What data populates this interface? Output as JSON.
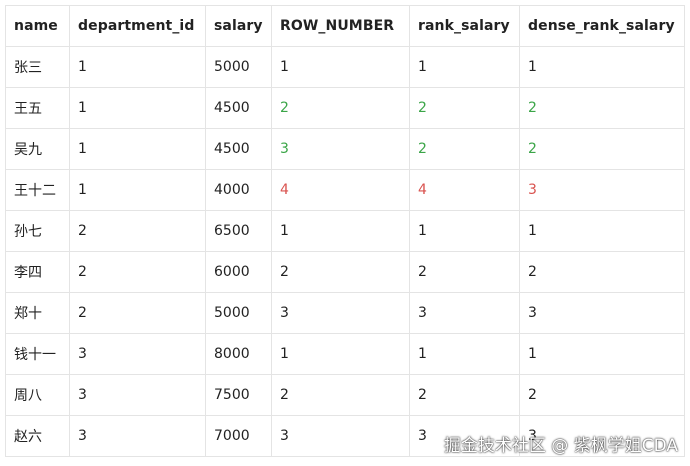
{
  "table": {
    "columns": [
      "name",
      "department_id",
      "salary",
      "ROW_NUMBER",
      "rank_salary",
      "dense_rank_salary"
    ],
    "rows": [
      {
        "name": "张三",
        "department_id": "1",
        "salary": "5000",
        "row_number": "1",
        "rank_salary": "1",
        "dense_rank_salary": "1"
      },
      {
        "name": "王五",
        "department_id": "1",
        "salary": "4500",
        "row_number": "2",
        "rank_salary": "2",
        "dense_rank_salary": "2"
      },
      {
        "name": "吴九",
        "department_id": "1",
        "salary": "4500",
        "row_number": "3",
        "rank_salary": "2",
        "dense_rank_salary": "2"
      },
      {
        "name": "王十二",
        "department_id": "1",
        "salary": "4000",
        "row_number": "4",
        "rank_salary": "4",
        "dense_rank_salary": "3"
      },
      {
        "name": "孙七",
        "department_id": "2",
        "salary": "6500",
        "row_number": "1",
        "rank_salary": "1",
        "dense_rank_salary": "1"
      },
      {
        "name": "李四",
        "department_id": "2",
        "salary": "6000",
        "row_number": "2",
        "rank_salary": "2",
        "dense_rank_salary": "2"
      },
      {
        "name": "郑十",
        "department_id": "2",
        "salary": "5000",
        "row_number": "3",
        "rank_salary": "3",
        "dense_rank_salary": "3"
      },
      {
        "name": "钱十一",
        "department_id": "3",
        "salary": "8000",
        "row_number": "1",
        "rank_salary": "1",
        "dense_rank_salary": "1"
      },
      {
        "name": "周八",
        "department_id": "3",
        "salary": "7500",
        "row_number": "2",
        "rank_salary": "2",
        "dense_rank_salary": "2"
      },
      {
        "name": "赵六",
        "department_id": "3",
        "salary": "7000",
        "row_number": "3",
        "rank_salary": "3",
        "dense_rank_salary": "3"
      }
    ],
    "highlight_colors": {
      "green": "#3aa547",
      "red": "#d9534f"
    }
  },
  "watermark": "掘金技术社区 @ 紫枫学姐CDA"
}
